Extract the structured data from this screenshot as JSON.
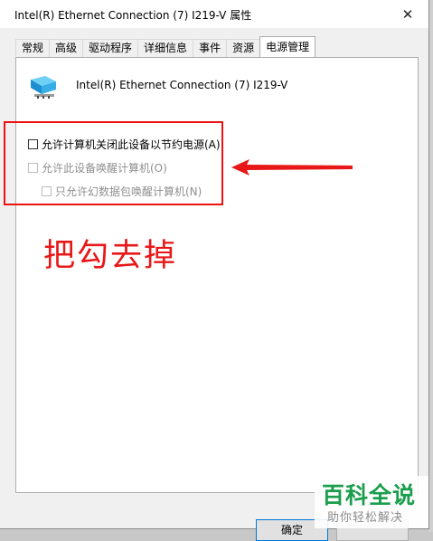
{
  "window": {
    "title": "Intel(R) Ethernet Connection (7) I219-V 属性",
    "close_glyph": "✕"
  },
  "tabs": [
    {
      "label": "常规",
      "active": false
    },
    {
      "label": "高级",
      "active": false
    },
    {
      "label": "驱动程序",
      "active": false
    },
    {
      "label": "详细信息",
      "active": false
    },
    {
      "label": "事件",
      "active": false
    },
    {
      "label": "资源",
      "active": false
    },
    {
      "label": "电源管理",
      "active": true
    }
  ],
  "panel": {
    "device_name": "Intel(R) Ethernet Connection (7) I219-V",
    "device_icon": "network-adapter-icon",
    "options": [
      {
        "label": "允许计算机关闭此设备以节约电源(A)",
        "checked": false,
        "enabled": true
      },
      {
        "label": "允许此设备唤醒计算机(O)",
        "checked": false,
        "enabled": false
      },
      {
        "label": "只允许幻数据包唤醒计算机(N)",
        "checked": false,
        "enabled": false
      }
    ]
  },
  "annotation": {
    "text": "把勾去掉",
    "color": "#e81818"
  },
  "buttons": {
    "ok_label": "确定"
  },
  "watermark": {
    "title": "百科全说",
    "subtitle": "助你轻松解决",
    "color": "#1a9d4c"
  }
}
